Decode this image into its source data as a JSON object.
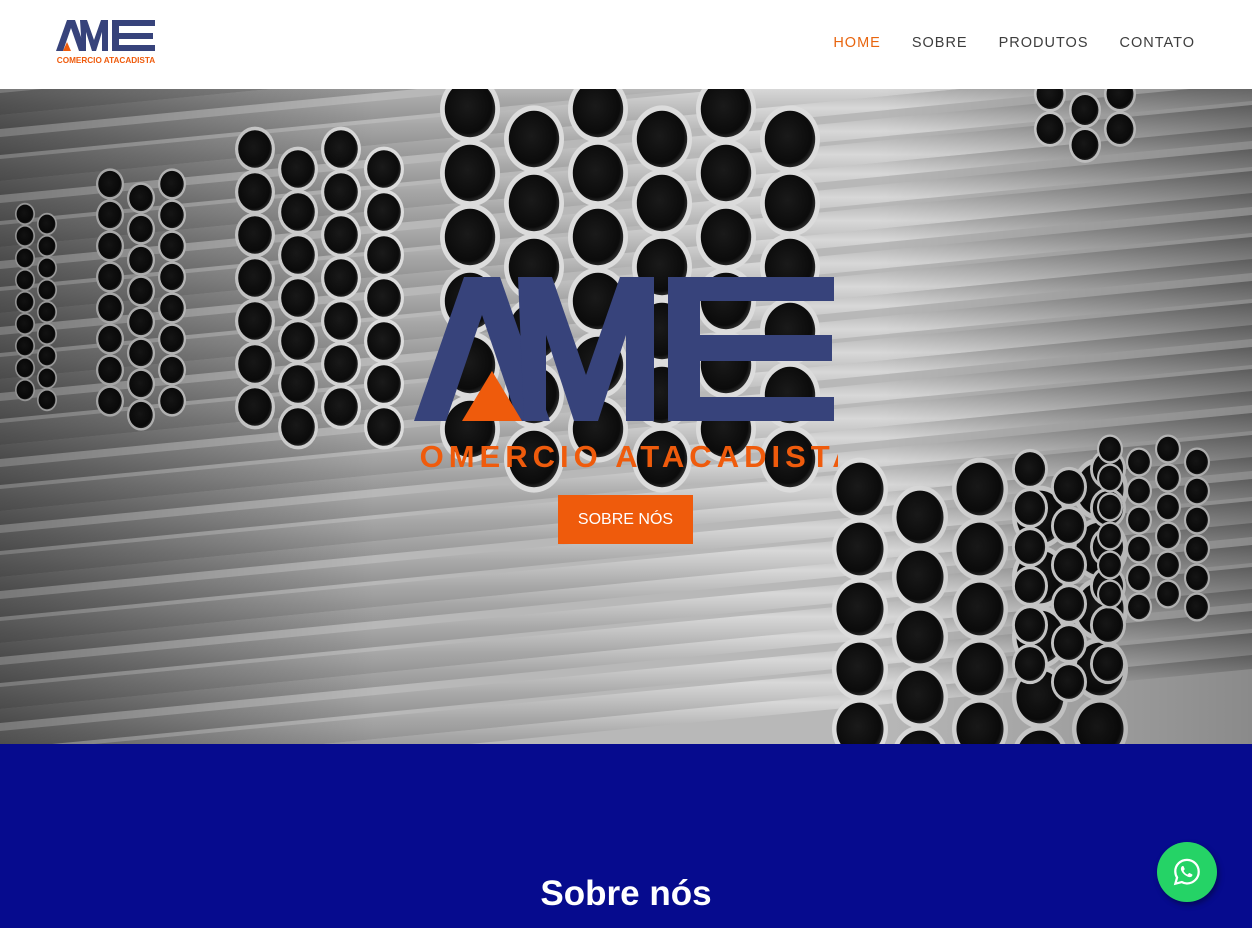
{
  "header": {
    "logo": {
      "brand_letters": "AME",
      "tagline": "COMERCIO ATACADISTA"
    },
    "nav": [
      {
        "label": "HOME",
        "active": true
      },
      {
        "label": "SOBRE",
        "active": false
      },
      {
        "label": "PRODUTOS",
        "active": false
      },
      {
        "label": "CONTATO",
        "active": false
      }
    ]
  },
  "hero": {
    "background": "steel-pipes-photo",
    "logo": {
      "brand_letters": "AME",
      "tagline": "COMERCIO ATACADISTA"
    },
    "button_label": "SOBRE NÓS"
  },
  "sobre": {
    "title": "Sobre nós"
  },
  "whatsapp": {
    "icon": "whatsapp-icon"
  },
  "colors": {
    "brand_blue": "#37437b",
    "brand_orange": "#ef5b0c",
    "section_blue": "#060b8e",
    "whatsapp_green": "#25d366",
    "nav_active": "#e8650f"
  }
}
